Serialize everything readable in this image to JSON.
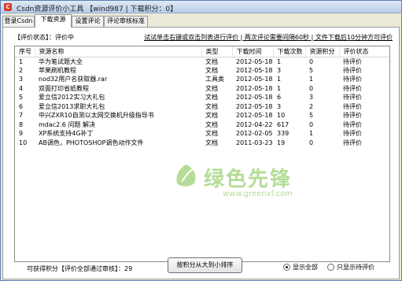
{
  "window": {
    "title": "Csdn资源评价小工具 【wind987 | 下载积分：0】"
  },
  "tabs": [
    {
      "label": "登录Csdn"
    },
    {
      "label": "下载资源"
    },
    {
      "label": "设置评论"
    },
    {
      "label": "评论审核标准"
    }
  ],
  "status": {
    "label": "【评价状态】：",
    "value": "评价中"
  },
  "notice": "试试单击右键或双击列表进行评价 | 两次评论需要间隔60秒 | 文件下载后10分钟方可评价",
  "table": {
    "columns": [
      "序号",
      "资源名称",
      "类型",
      "下载时间",
      "下载次数",
      "资源积分",
      "评价状态"
    ],
    "rows": [
      [
        "1",
        "华为笔试题大全",
        "文档",
        "2012-05-18",
        "1",
        "0",
        "待评价"
      ],
      [
        "2",
        "苹果刷机教程",
        "文档",
        "2012-05-18",
        "3",
        "5",
        "待评价"
      ],
      [
        "3",
        "nod32用户名获取器.rar",
        "工具类",
        "2012-05-18",
        "1",
        "1",
        "待评价"
      ],
      [
        "4",
        "双面打印省纸教程",
        "文档",
        "2012-05-18",
        "1",
        "0",
        "待评价"
      ],
      [
        "5",
        "爱立信2012实习大礼包",
        "文档",
        "2012-05-18",
        "6",
        "3",
        "待评价"
      ],
      [
        "6",
        "爱立信2013求职大礼包",
        "文档",
        "2012-05-18",
        "3",
        "2",
        "待评价"
      ],
      [
        "7",
        "中兴ZXR10自测以太网交换机升级指导书",
        "文档",
        "2012-05-18",
        "10",
        "5",
        "待评价"
      ],
      [
        "8",
        "mdac2.6 问题 解决",
        "文档",
        "2012-04-22",
        "617",
        "0",
        "待评价"
      ],
      [
        "9",
        "XP系统支持4G补丁",
        "文档",
        "2012-02-05",
        "339",
        "1",
        "待评价"
      ],
      [
        "10",
        "AB调色，PHOTOSHOP调色动作文件",
        "文档",
        "2011-03-23",
        "19",
        "0",
        "待评价"
      ]
    ]
  },
  "watermark": {
    "cn": "绿色先锋",
    "url": "www.greenxf.com",
    "badge": "GREENXF"
  },
  "footer": {
    "count_label": "可获得积分【评价全部通过审核】：",
    "count_value": "29",
    "sort_button": "按积分从大到小排序",
    "radio_all": "显示全部",
    "radio_pending": "只显示待评价"
  }
}
